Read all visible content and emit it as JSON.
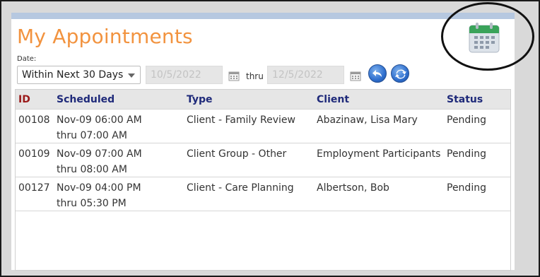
{
  "page": {
    "title": "My Appointments"
  },
  "filter": {
    "date_label": "Date:",
    "date_range_selected": "Within Next 30 Days",
    "start_date": "10/5/2022",
    "thru_label": "thru",
    "end_date": "12/5/2022"
  },
  "table": {
    "headers": {
      "id": "ID",
      "scheduled": "Scheduled",
      "type": "Type",
      "client": "Client",
      "status": "Status"
    },
    "rows": [
      {
        "id": "00108",
        "scheduled_line1": "Nov-09 06:00 AM",
        "scheduled_line2": "thru 07:00 AM",
        "type": "Client - Family Review",
        "client": "Abazinaw, Lisa Mary",
        "status": "Pending"
      },
      {
        "id": "00109",
        "scheduled_line1": "Nov-09 07:00 AM",
        "scheduled_line2": "thru 08:00 AM",
        "type": "Client Group - Other",
        "client": "Employment Participants",
        "status": "Pending"
      },
      {
        "id": "00127",
        "scheduled_line1": "Nov-09 04:00 PM",
        "scheduled_line2": "thru 05:30 PM",
        "type": "Client - Care Planning",
        "client": "Albertson, Bob",
        "status": "Pending"
      }
    ]
  },
  "colors": {
    "title": "#f2933f",
    "header_text": "#1f2a7a",
    "id_header": "#9b1b1b",
    "calendar_green": "#3aa35a",
    "panel_strip": "#b6c8e0"
  },
  "icons": {
    "calendar_large": "calendar-icon",
    "calendar_small": "calendar-icon",
    "back": "undo-arrow-icon",
    "refresh": "refresh-icon"
  }
}
